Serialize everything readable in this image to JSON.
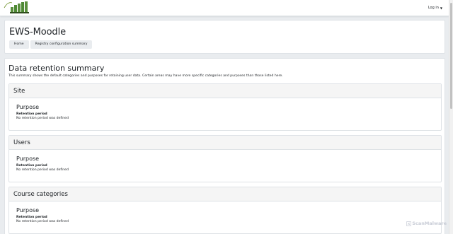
{
  "navbar": {
    "logo_icon": "site-logo-icon",
    "login_label": "Log in"
  },
  "header": {
    "site_title": "EWS-Moodle",
    "breadcrumb": [
      {
        "label": "Home"
      },
      {
        "label": "Registry configuration summary"
      }
    ]
  },
  "main": {
    "heading": "Data retention summary",
    "intro": "This summary shows the default categories and purposes for retaining user data. Certain areas may have more specific categories and purposes than those listed here.",
    "sections": [
      {
        "title": "Site",
        "purpose_heading": "Purpose",
        "retention_label": "Retention period",
        "retention_value": "No retention period was defined"
      },
      {
        "title": "Users",
        "purpose_heading": "Purpose",
        "retention_label": "Retention period",
        "retention_value": "No retention period was defined"
      },
      {
        "title": "Course categories",
        "purpose_heading": "Purpose",
        "retention_label": "Retention period",
        "retention_value": "No retention period was defined"
      }
    ]
  },
  "watermark": {
    "text": "ScanMalware",
    "icon": "scanmalware-logo-icon"
  },
  "colors": {
    "background": "#e9ecef",
    "card": "#ffffff",
    "border": "#dee2e6",
    "section_header": "#f5f5f5",
    "text": "#1d2125"
  }
}
